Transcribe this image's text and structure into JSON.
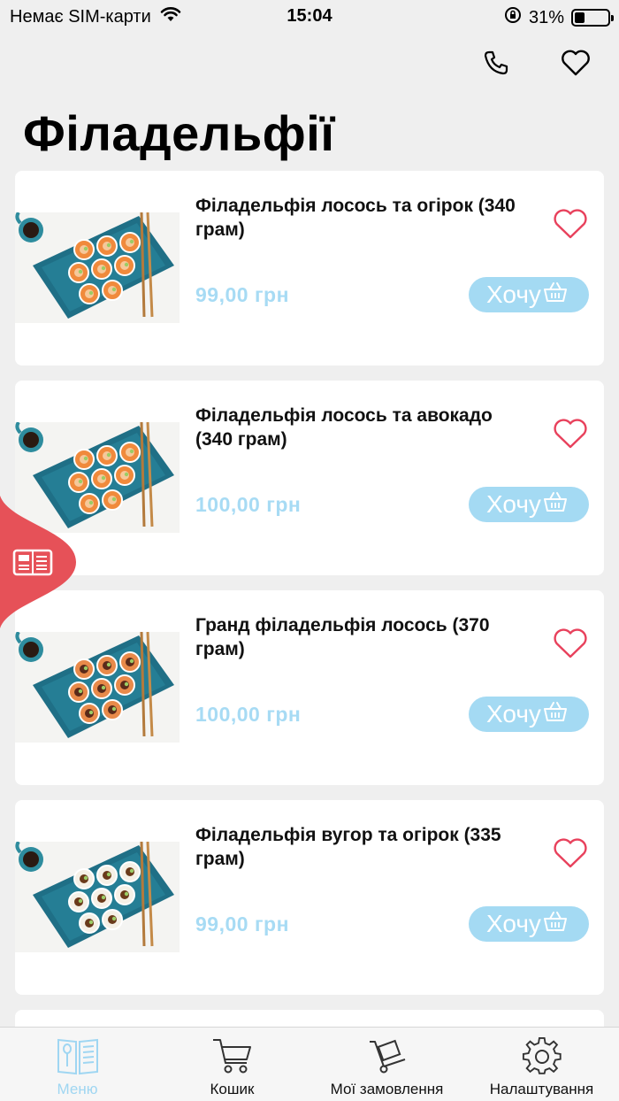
{
  "status_bar": {
    "carrier": "Немає SIM-карти",
    "time": "15:04",
    "battery_percent": "31%",
    "battery_level": 0.31
  },
  "page": {
    "title": "Філадельфії"
  },
  "products": [
    {
      "name": "Філадельфія лосось та огірок (340 грам)",
      "price": "99,00 грн",
      "button": "Хочу"
    },
    {
      "name": "Філадельфія лосось та авокадо (340 грам)",
      "price": "100,00 грн",
      "button": "Хочу"
    },
    {
      "name": "Гранд філадельфія лосось (370 грам)",
      "price": "100,00 грн",
      "button": "Хочу"
    },
    {
      "name": "Філадельфія вугор та огірок (335 грам)",
      "price": "99,00 грн",
      "button": "Хочу"
    }
  ],
  "tabs": [
    {
      "label": "Меню",
      "icon": "menu-book-icon",
      "active": true
    },
    {
      "label": "Кошик",
      "icon": "cart-icon",
      "active": false
    },
    {
      "label": "Мої замовлення",
      "icon": "hand-truck-icon",
      "active": false
    },
    {
      "label": "Налаштування",
      "icon": "gear-icon",
      "active": false
    }
  ],
  "colors": {
    "accent": "#a4daf3",
    "price": "#a7dbf4",
    "heart": "#e8415c",
    "floating_tab": "#e65158",
    "active_tab": "#9fd6f2"
  }
}
